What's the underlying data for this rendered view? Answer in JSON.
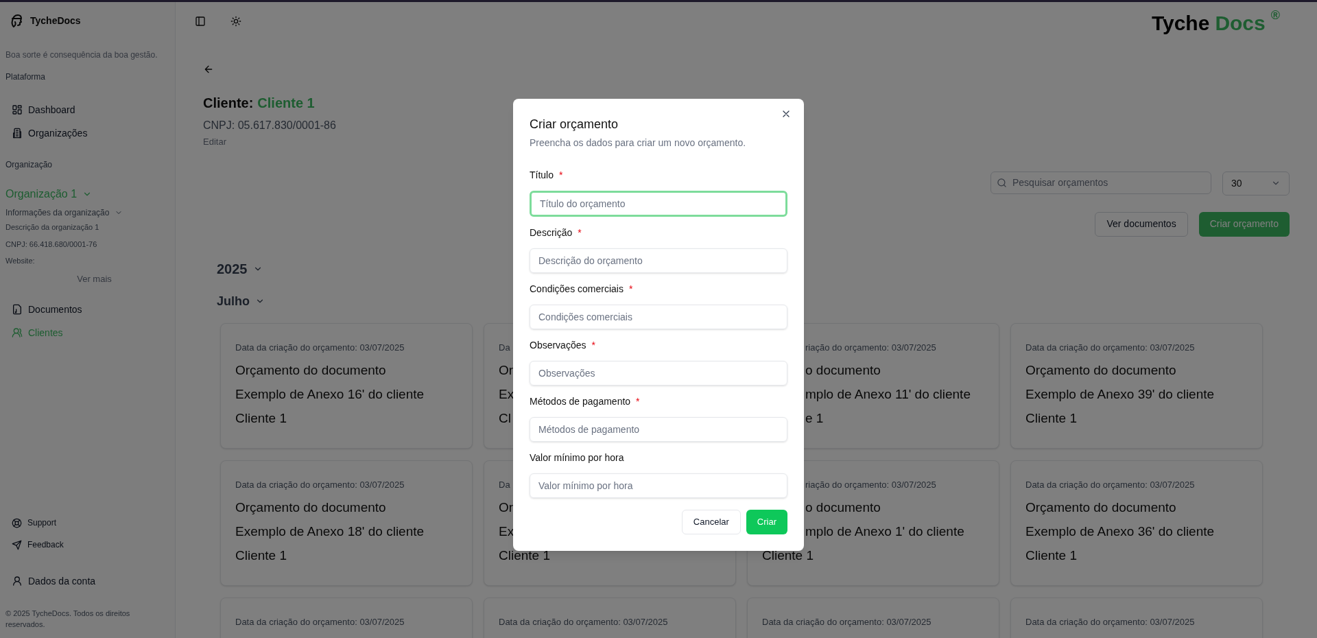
{
  "sidebar": {
    "brand": "TycheDocs",
    "tagline": "Boa sorte é consequência da boa gestão.",
    "platform_label": "Plataforma",
    "platform_items": [
      {
        "label": "Dashboard",
        "selected": false
      },
      {
        "label": "Organizações",
        "selected": false
      }
    ],
    "organization_label": "Organização",
    "organization": {
      "name": "Organização 1",
      "info_label": "Informações da organização",
      "description": "Descrição da organização 1",
      "cnpj": "CNPJ: 66.418.680/0001-76",
      "website": "Website:",
      "more": "Ver mais"
    },
    "org_items": [
      {
        "label": "Documentos",
        "selected": false
      },
      {
        "label": "Clientes",
        "selected": true
      }
    ],
    "footer_links": [
      "Support",
      "Feedback"
    ],
    "account": "Dados da conta",
    "copyright": "© 2025 TycheDocs. Todos os direitos reservados."
  },
  "header": {
    "logo_main": "Tyche",
    "logo_accent": "Docs",
    "logo_mark": "®"
  },
  "client": {
    "label": "Cliente:",
    "name": "Cliente 1",
    "cnpj": "CNPJ: 05.617.830/0001-86",
    "edit": "Editar"
  },
  "toolbar": {
    "search_placeholder": "Pesquisar orçamentos",
    "page_size": "30",
    "buttons": [
      "Ver documentos",
      "Criar orçamento"
    ]
  },
  "groups": {
    "year": "2025",
    "month": "Julho"
  },
  "cards": [
    {
      "lines": [
        "Data da criação do orçamento: 03/07/2025",
        "Orçamento do documento",
        "Exemplo de Anexo 16' do cliente",
        "Cliente 1"
      ]
    },
    {
      "lines": [
        "Da",
        "Or",
        "Ex",
        "Cl"
      ]
    },
    {
      "lines": [
        "riação do orçamento: 03/07/2025",
        "o documento",
        "mplo de Anexo 11' do cliente",
        "e 1"
      ]
    },
    {
      "lines": [
        "Data da criação do orçamento: 03/07/2025",
        "Orçamento do documento",
        "Exemplo de Anexo 39' do cliente",
        "Cliente 1"
      ]
    },
    {
      "lines": [
        "Data da criação do orçamento: 03/07/2025",
        "Orçamento do documento",
        "Exemplo de Anexo 18' do cliente",
        "Cliente 1"
      ]
    },
    {
      "lines": [
        "Da",
        "Or",
        "Ex",
        "Cliente 1"
      ]
    },
    {
      "lines": [
        "riação do orçamento: 03/07/2025",
        "o documento",
        "mplo de Anexo 1' do cliente",
        "Cliente 1"
      ]
    },
    {
      "lines": [
        "Data da criação do orçamento: 03/07/2025",
        "Orçamento do documento",
        "Exemplo de Anexo 36' do cliente",
        "Cliente 1"
      ]
    },
    {
      "lines": [
        "Data da criação do orçamento: 03/07/2025"
      ]
    },
    {
      "lines": [
        "Data da criação do orçamento: 03/07/2025"
      ]
    },
    {
      "lines": [
        "Data da criação do orçamento: 03/07/2025"
      ]
    },
    {
      "lines": [
        "Data da criação do orçamento: 03/07/2025"
      ]
    }
  ],
  "dialog": {
    "title": "Criar orçamento",
    "required_mark": "*",
    "subtitle": "Preencha os dados para criar um novo orçamento.",
    "fields": [
      {
        "label": "Título",
        "required": true,
        "placeholder": "Título do orçamento",
        "focused": true
      },
      {
        "label": "Descrição",
        "required": true,
        "placeholder": "Descrição do orçamento",
        "focused": false
      },
      {
        "label": "Condições comerciais",
        "required": true,
        "placeholder": "Condições comerciais",
        "focused": false
      },
      {
        "label": "Observações",
        "required": true,
        "placeholder": "Observações",
        "focused": false
      },
      {
        "label": "Métodos de pagamento",
        "required": true,
        "placeholder": "Métodos de pagamento",
        "focused": false
      },
      {
        "label": "Valor mínimo por hora",
        "required": false,
        "placeholder": "Valor mínimo por hora",
        "focused": false
      }
    ],
    "buttons": [
      "Cancelar",
      "Criar"
    ]
  }
}
